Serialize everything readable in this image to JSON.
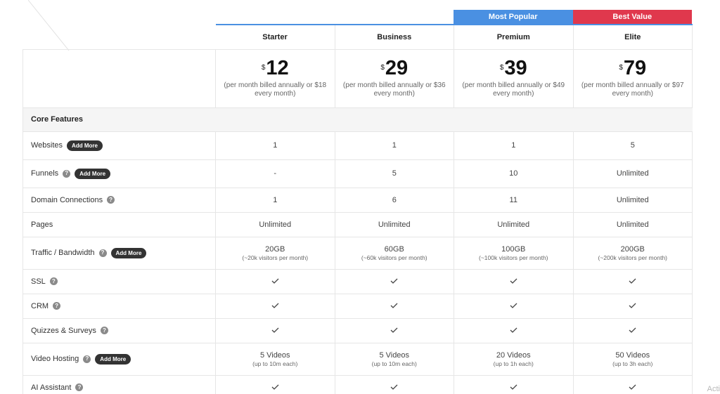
{
  "ribbons": [
    {
      "label": "",
      "color": ""
    },
    {
      "label": "",
      "color": ""
    },
    {
      "label": "Most Popular",
      "color": "#4a90e2"
    },
    {
      "label": "Best Value",
      "color": "#e0384d"
    }
  ],
  "plans": [
    {
      "name": "Starter",
      "currency": "$",
      "price": "12",
      "note": "(per month billed annually or $18 every month)"
    },
    {
      "name": "Business",
      "currency": "$",
      "price": "29",
      "note": "(per month billed annually or $36 every month)"
    },
    {
      "name": "Premium",
      "currency": "$",
      "price": "39",
      "note": "(per month billed annually or $49 every month)"
    },
    {
      "name": "Elite",
      "currency": "$",
      "price": "79",
      "note": "(per month billed annually or $97 every month)"
    }
  ],
  "section_title": "Core Features",
  "add_more_label": "Add More",
  "help_glyph": "?",
  "features": {
    "websites": {
      "label": "Websites",
      "values": [
        "1",
        "1",
        "1",
        "5"
      ]
    },
    "funnels": {
      "label": "Funnels",
      "values": [
        "-",
        "5",
        "10",
        "Unlimited"
      ]
    },
    "domains": {
      "label": "Domain Connections",
      "values": [
        "1",
        "6",
        "11",
        "Unlimited"
      ]
    },
    "pages": {
      "label": "Pages",
      "values": [
        "Unlimited",
        "Unlimited",
        "Unlimited",
        "Unlimited"
      ]
    },
    "traffic": {
      "label": "Traffic / Bandwidth",
      "values": [
        "20GB",
        "60GB",
        "100GB",
        "200GB"
      ],
      "subs": [
        "(~20k visitors per month)",
        "(~60k visitors per month)",
        "(~100k visitors per month)",
        "(~200k visitors per month)"
      ]
    },
    "ssl": {
      "label": "SSL"
    },
    "crm": {
      "label": "CRM"
    },
    "quizzes": {
      "label": "Quizzes & Surveys"
    },
    "video": {
      "label": "Video Hosting",
      "values": [
        "5 Videos",
        "5 Videos",
        "20 Videos",
        "50 Videos"
      ],
      "subs": [
        "(up to 10m each)",
        "(up to 10m each)",
        "(up to 1h each)",
        "(up to 3h each)"
      ]
    },
    "ai": {
      "label": "AI Assistant"
    }
  },
  "watermark": "Acti",
  "icons": {
    "check": "check-icon",
    "help": "help-circle-icon"
  }
}
